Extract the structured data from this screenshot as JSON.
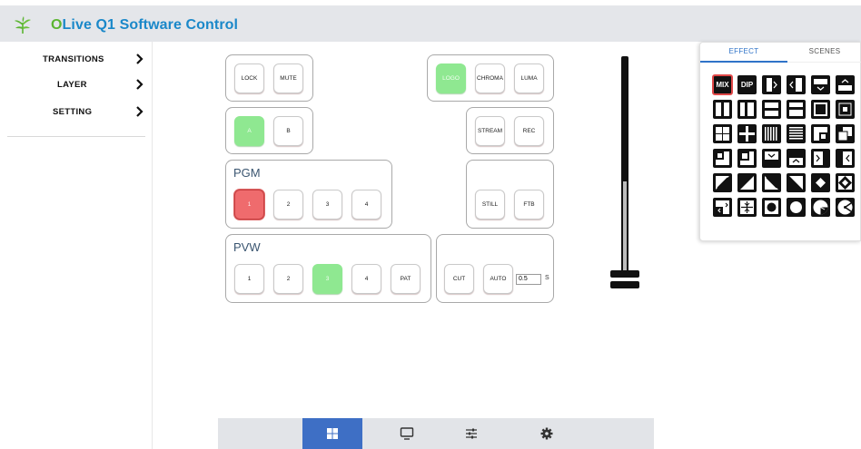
{
  "app": {
    "title_o": "O",
    "title_rest": "Live Q1 Software Control",
    "brand_color": "#1a88c9",
    "logo_color": "#5bb531"
  },
  "sidebar": {
    "items": [
      {
        "label": "TRANSITIONS"
      },
      {
        "label": "LAYER"
      },
      {
        "label": "SETTING"
      }
    ]
  },
  "keyers": {
    "lock": "LOCK",
    "mute": "MUTE",
    "logo": "LOGO",
    "chroma": "CHROMA",
    "luma": "LUMA"
  },
  "ab": {
    "a": "A",
    "b": "B"
  },
  "output": {
    "stream": "STREAM",
    "rec": "REC",
    "still": "STILL",
    "ftb": "FTB"
  },
  "pgm": {
    "label": "PGM",
    "buttons": [
      "1",
      "2",
      "3",
      "4"
    ],
    "active": "1"
  },
  "pvw": {
    "label": "PVW",
    "buttons": [
      "1",
      "2",
      "3",
      "4",
      "PAT"
    ],
    "active": "3"
  },
  "transition": {
    "cut": "CUT",
    "auto": "AUTO",
    "duration": "0.5",
    "unit": "S"
  },
  "effects": {
    "tab_effect": "EFFECT",
    "tab_scenes": "SCENES",
    "mix": "MIX",
    "dip": "DIP"
  },
  "colors": {
    "active_green": "#8fe891",
    "active_red": "#ef6b6d",
    "tab_active": "#2f73c8",
    "nav_active": "#3e6fc5"
  },
  "bottom_nav": [
    "grid-icon",
    "monitor-icon",
    "sliders-icon",
    "gear-icon"
  ]
}
